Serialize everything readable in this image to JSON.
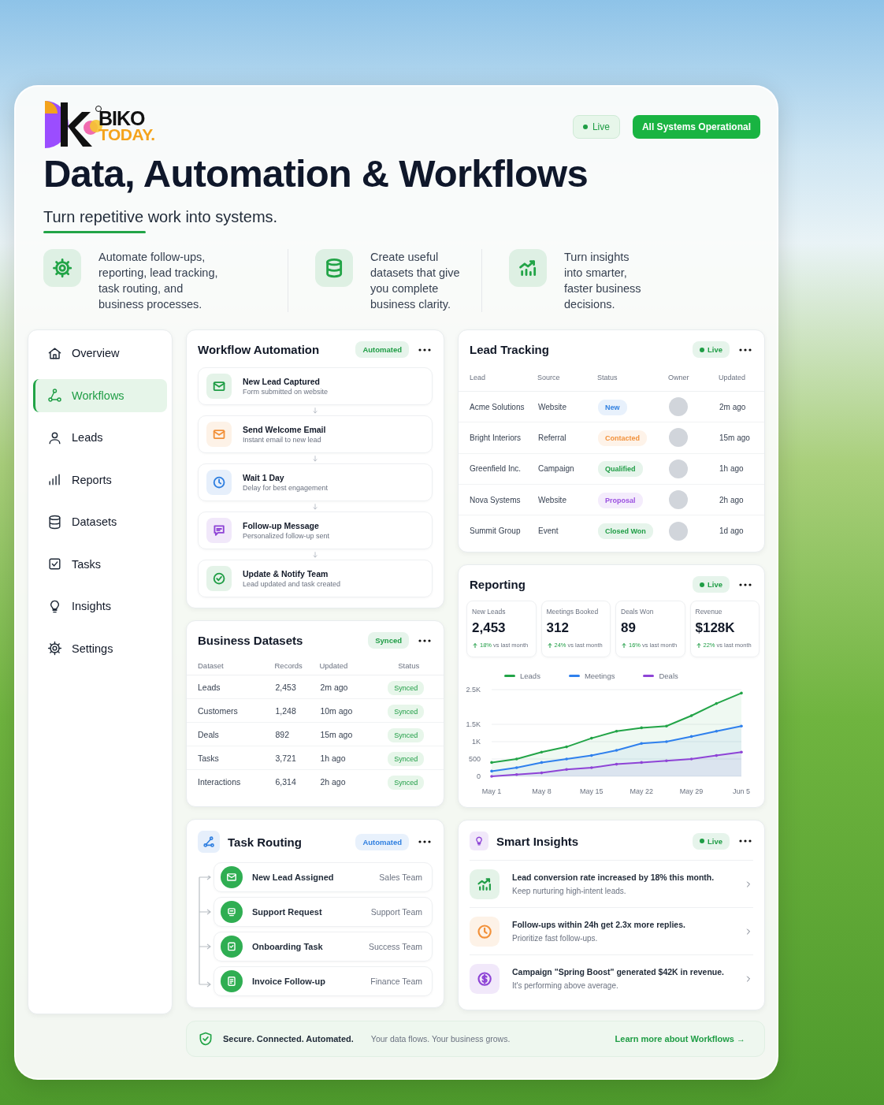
{
  "header": {
    "logo": {
      "name": "BIKO",
      "tagline": "TODAY."
    },
    "live_badge": {
      "text": "Live",
      "dot": true
    },
    "status_badge": "All Systems Operational",
    "title": "Data, Automation & Workflows",
    "subtitle": "Turn repetitive work into systems."
  },
  "features": [
    {
      "text": "Automate follow-ups, reporting, lead tracking, task routing, and business processes."
    },
    {
      "text": "Create useful datasets that give you complete business clarity."
    },
    {
      "text": "Turn insights into smarter, faster business decisions."
    }
  ],
  "sidebar": {
    "items": [
      {
        "label": "Overview",
        "selected": false
      },
      {
        "label": "Workflows",
        "selected": true
      },
      {
        "label": "Leads",
        "selected": false
      },
      {
        "label": "Reports",
        "selected": false
      },
      {
        "label": "Datasets",
        "selected": false
      },
      {
        "label": "Tasks",
        "selected": false
      },
      {
        "label": "Insights",
        "selected": false
      },
      {
        "label": "Settings",
        "selected": false
      }
    ]
  },
  "workflow_automation": {
    "title": "Workflow Automation",
    "badge": {
      "text": "Automated",
      "color": "#1f9d45"
    },
    "steps": [
      {
        "title": "New Lead Captured",
        "subtitle": "Form submitted on website",
        "color": "#1f9d45"
      },
      {
        "title": "Send Welcome Email",
        "subtitle": "Instant email to new lead",
        "color": "#f2913a"
      },
      {
        "title": "Wait 1 Day",
        "subtitle": "Delay for best engagement",
        "color": "#2f7fe0"
      },
      {
        "title": "Follow-up Message",
        "subtitle": "Personalized follow-up sent",
        "color": "#8e44d6"
      },
      {
        "title": "Update & Notify Team",
        "subtitle": "Lead updated and task created",
        "color": "#1f9d45"
      }
    ]
  },
  "business_datasets": {
    "title": "Business Datasets",
    "badge": {
      "text": "Synced",
      "color": "#1f9d45"
    },
    "columns": [
      "Dataset",
      "Records",
      "Updated",
      "Status"
    ],
    "rows": [
      {
        "dataset": "Leads",
        "records": "2,453",
        "updated": "2m ago",
        "status": "Synced"
      },
      {
        "dataset": "Customers",
        "records": "1,248",
        "updated": "10m ago",
        "status": "Synced"
      },
      {
        "dataset": "Deals",
        "records": "892",
        "updated": "15m ago",
        "status": "Synced"
      },
      {
        "dataset": "Tasks",
        "records": "3,721",
        "updated": "1h ago",
        "status": "Synced"
      },
      {
        "dataset": "Interactions",
        "records": "6,314",
        "updated": "2h ago",
        "status": "Synced"
      }
    ]
  },
  "task_routing": {
    "title": "Task Routing",
    "badge": {
      "text": "Automated",
      "color": "#2f7fe0"
    },
    "items": [
      {
        "title": "New Lead Assigned",
        "team": "Sales Team"
      },
      {
        "title": "Support Request",
        "team": "Support Team"
      },
      {
        "title": "Onboarding Task",
        "team": "Success Team"
      },
      {
        "title": "Invoice Follow-up",
        "team": "Finance Team"
      }
    ]
  },
  "lead_tracking": {
    "title": "Lead Tracking",
    "badge": {
      "text": "Live",
      "color": "#1f9d45",
      "dot": true
    },
    "columns": [
      "Lead",
      "Source",
      "Status",
      "Owner",
      "Updated"
    ],
    "rows": [
      {
        "lead": "Acme Solutions",
        "source": "Website",
        "status": {
          "text": "New",
          "color": "#2f7fe0"
        },
        "updated": "2m ago"
      },
      {
        "lead": "Bright Interiors",
        "source": "Referral",
        "status": {
          "text": "Contacted",
          "color": "#f2913a"
        },
        "updated": "15m ago"
      },
      {
        "lead": "Greenfield Inc.",
        "source": "Campaign",
        "status": {
          "text": "Qualified",
          "color": "#1f9d45"
        },
        "updated": "1h ago"
      },
      {
        "lead": "Nova Systems",
        "source": "Website",
        "status": {
          "text": "Proposal",
          "color": "#9b51e0"
        },
        "updated": "2h ago"
      },
      {
        "lead": "Summit Group",
        "source": "Event",
        "status": {
          "text": "Closed Won",
          "color": "#1f9d45"
        },
        "updated": "1d ago"
      }
    ]
  },
  "reporting": {
    "title": "Reporting",
    "badge": {
      "text": "Live",
      "color": "#1f9d45",
      "dot": true
    },
    "stats": [
      {
        "label": "New Leads",
        "value": "2,453",
        "change": "18%",
        "note": "vs last month"
      },
      {
        "label": "Meetings Booked",
        "value": "312",
        "change": "24%",
        "note": "vs last month"
      },
      {
        "label": "Deals Won",
        "value": "89",
        "change": "16%",
        "note": "vs last month"
      },
      {
        "label": "Revenue",
        "value": "$128K",
        "change": "22%",
        "note": "vs last month"
      }
    ],
    "chart_data": {
      "type": "area",
      "grid": true,
      "legend": "top",
      "categories": [
        "May 1",
        null,
        "May 8",
        null,
        "May 15",
        null,
        "May 22",
        null,
        "May 29",
        null,
        "Jun 5"
      ],
      "ylim": [
        0,
        2500
      ],
      "yticks": [
        {
          "value": 0,
          "label": "0"
        },
        {
          "value": 500,
          "label": "500"
        },
        {
          "value": 1000,
          "label": "1K"
        },
        {
          "value": 1500,
          "label": "1.5K"
        },
        {
          "value": 2500,
          "label": "2.5K"
        }
      ],
      "series": [
        {
          "name": "Leads",
          "color": "#22a447",
          "values": [
            400,
            500,
            700,
            850,
            1100,
            1300,
            1400,
            1450,
            1750,
            2100,
            2400
          ]
        },
        {
          "name": "Meetings",
          "color": "#2f80ed",
          "values": [
            150,
            250,
            400,
            500,
            600,
            750,
            950,
            1000,
            1150,
            1300,
            1450
          ]
        },
        {
          "name": "Deals",
          "color": "#8e44d6",
          "values": [
            0,
            50,
            100,
            200,
            250,
            350,
            400,
            450,
            500,
            600,
            700
          ]
        }
      ]
    }
  },
  "smart_insights": {
    "title": "Smart Insights",
    "badge": {
      "text": "Live",
      "color": "#1f9d45",
      "dot": true
    },
    "items": [
      {
        "title": "Lead conversion rate increased by 18% this month.",
        "subtitle": "Keep nurturing high-intent leads.",
        "color": "#1f9d45"
      },
      {
        "title": "Follow-ups within 24h get 2.3x more replies.",
        "subtitle": "Prioritize fast follow-ups.",
        "color": "#f2913a"
      },
      {
        "title": "Campaign \"Spring Boost\" generated $42K in revenue.",
        "subtitle": "It's performing above average.",
        "color": "#8e44d6"
      }
    ]
  },
  "footer": {
    "title": "Secure. Connected. Automated.",
    "text": "Your data flows. Your business grows.",
    "link": "Learn more about Workflows →"
  }
}
